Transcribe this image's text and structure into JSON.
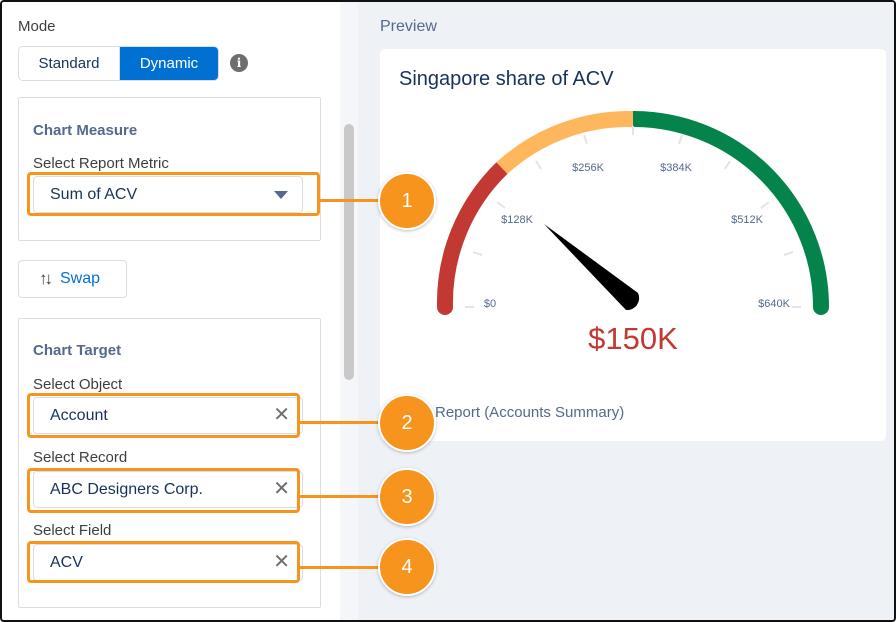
{
  "mode": {
    "label": "Mode",
    "options": [
      "Standard",
      "Dynamic"
    ],
    "selected": "Dynamic",
    "info_icon": "info-icon"
  },
  "chart_measure": {
    "title": "Chart Measure",
    "metric_label": "Select Report Metric",
    "metric_value": "Sum of ACV"
  },
  "swap": {
    "icon": "swap-arrows-icon",
    "label": "Swap"
  },
  "chart_target": {
    "title": "Chart Target",
    "object_label": "Select Object",
    "object_value": "Account",
    "record_label": "Select Record",
    "record_value": "ABC Designers Corp.",
    "field_label": "Select Field",
    "field_value": "ACV"
  },
  "preview": {
    "label": "Preview",
    "title": "Singapore share of ACV",
    "value_label": "$150K",
    "ticks": [
      "$0",
      "$128K",
      "$256K",
      "$384K",
      "$512K",
      "$640K"
    ],
    "report_link": "Report (Accounts Summary)",
    "colors": {
      "low": "#c23934",
      "mid": "#ffb75d",
      "high": "#04844b",
      "value": "#c23934"
    }
  },
  "callouts": [
    "1",
    "2",
    "3",
    "4"
  ],
  "accent_color": "#f7941d"
}
